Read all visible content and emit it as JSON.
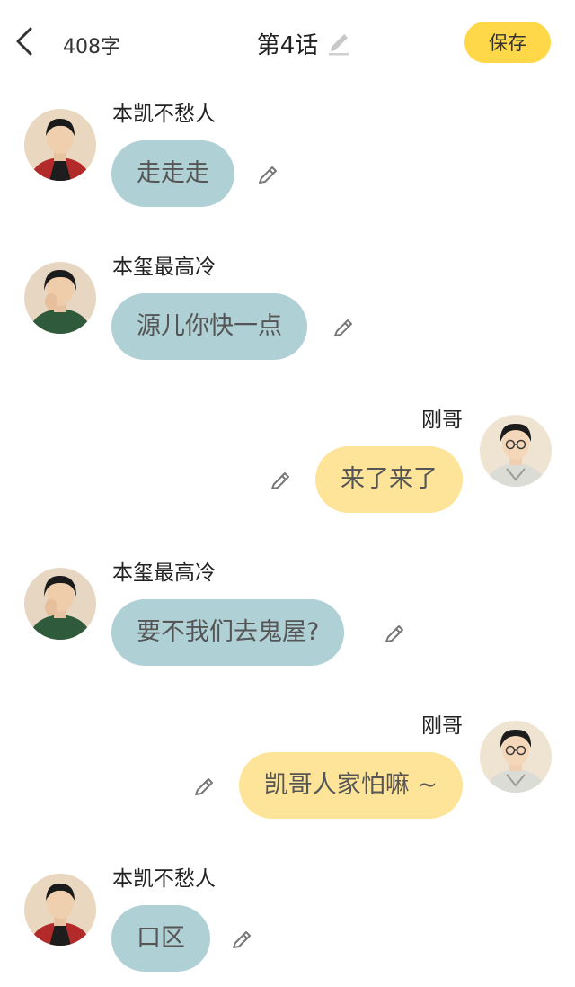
{
  "header": {
    "word_count": "408字",
    "title": "第4话",
    "save_label": "保存",
    "accent_color": "#ffd84a"
  },
  "messages": [
    {
      "side": "left",
      "sender": "本凯不愁人",
      "text": "走走走",
      "avatar": "boy-red-jacket-avatar"
    },
    {
      "side": "left",
      "sender": "本玺最高冷",
      "text": "源儿你快一点",
      "avatar": "boy-green-sweater-avatar"
    },
    {
      "side": "right",
      "sender": "刚哥",
      "text": "来了来了",
      "avatar": "boy-glasses-avatar"
    },
    {
      "side": "left",
      "sender": "本玺最高冷",
      "text": "要不我们去鬼屋?",
      "avatar": "boy-green-sweater-avatar"
    },
    {
      "side": "right",
      "sender": "刚哥",
      "text": "凯哥人家怕嘛 ~",
      "avatar": "boy-glasses-avatar"
    },
    {
      "side": "left",
      "sender": "本凯不愁人",
      "text": "口区",
      "avatar": "boy-red-jacket-avatar"
    }
  ],
  "colors": {
    "left_bubble": "#afd0d5",
    "right_bubble": "#fde498"
  }
}
